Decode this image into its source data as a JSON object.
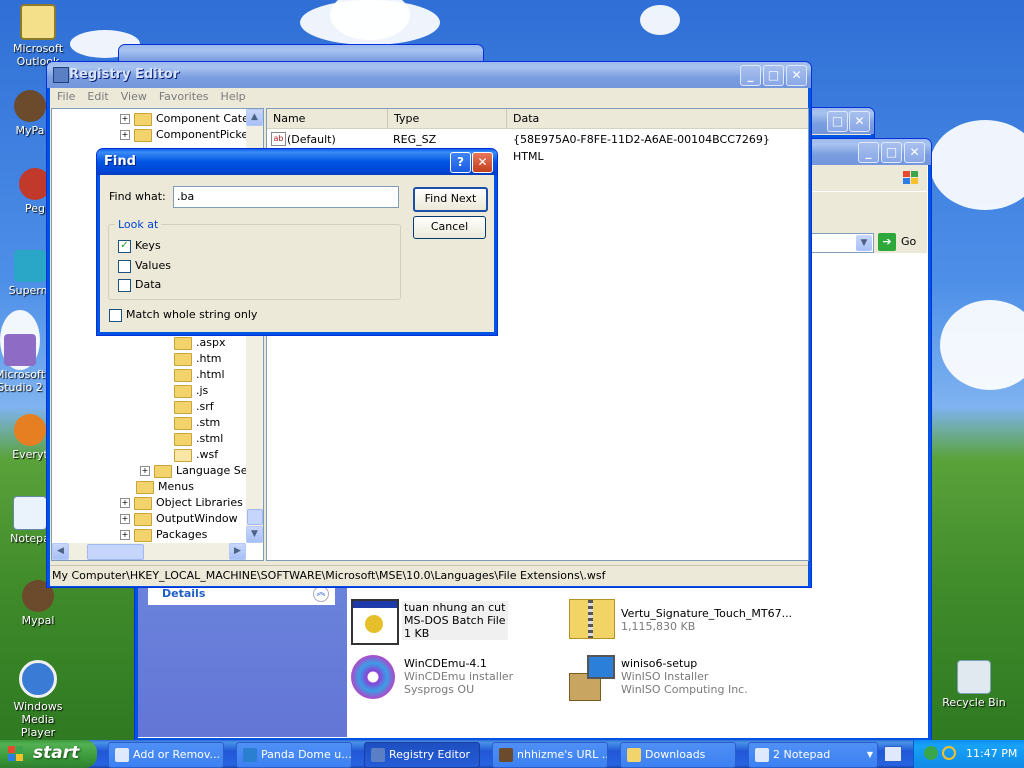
{
  "desktop": {
    "icons": [
      {
        "label": "Microsoft Outlook",
        "icon": "outlook-icon"
      },
      {
        "label": "MyPa",
        "icon": "mypa-icon"
      },
      {
        "label": "Peg",
        "icon": "peg-icon"
      },
      {
        "label": "Superm",
        "icon": "superm-icon"
      },
      {
        "label": "Microsoft Studio 2",
        "icon": "studio-icon"
      },
      {
        "label": "Everyt",
        "icon": "everything-icon"
      },
      {
        "label": "Notepa",
        "icon": "notepad-icon"
      },
      {
        "label": "Mypal",
        "icon": "mypal-icon"
      },
      {
        "label": "Windows Media Player",
        "icon": "media-player-icon"
      },
      {
        "label": "Recycle Bin",
        "icon": "recycle-bin-icon"
      }
    ]
  },
  "explorer": {
    "go_label": "Go",
    "details_label": "Details",
    "files": [
      {
        "name": "tuan nhung an cut",
        "line2": "MS-DOS Batch File",
        "line3": "1 KB",
        "icon": "batch-file-icon"
      },
      {
        "name": "Vertu_Signature_Touch_MT67...",
        "line2": "1,115,830 KB",
        "line3": "",
        "icon": "zip-folder-icon"
      },
      {
        "name": "WinCDEmu-4.1",
        "line2": "WinCDEmu installer",
        "line3": "Sysprogs OU",
        "icon": "disc-icon"
      },
      {
        "name": "winiso6-setup",
        "line2": "WinISO Installer",
        "line3": "WinISO Computing Inc.",
        "icon": "installer-icon"
      }
    ]
  },
  "regedit": {
    "title": "Registry Editor",
    "menu": [
      "File",
      "Edit",
      "View",
      "Favorites",
      "Help"
    ],
    "tree": [
      {
        "label": "Component Categ",
        "expander": "+"
      },
      {
        "label": "ComponentPickerF",
        "expander": "+"
      },
      {
        "label": ".aspx",
        "expander": ""
      },
      {
        "label": ".htm",
        "expander": ""
      },
      {
        "label": ".html",
        "expander": ""
      },
      {
        "label": ".js",
        "expander": ""
      },
      {
        "label": ".srf",
        "expander": ""
      },
      {
        "label": ".stm",
        "expander": ""
      },
      {
        "label": ".stml",
        "expander": ""
      },
      {
        "label": ".wsf",
        "expander": ""
      },
      {
        "label": "Language Serv",
        "expander": "+"
      },
      {
        "label": "Menus",
        "expander": ""
      },
      {
        "label": "Object Libraries",
        "expander": "+"
      },
      {
        "label": "OutputWindow",
        "expander": "+"
      },
      {
        "label": "Packages",
        "expander": "+"
      }
    ],
    "columns": [
      "Name",
      "Type",
      "Data"
    ],
    "values": [
      {
        "name": "(Default)",
        "type": "REG_SZ",
        "data": "{58E975A0-F8FE-11D2-A6AE-00104BCC7269}"
      },
      {
        "name": "",
        "type": "",
        "data": "HTML"
      }
    ],
    "status": "My Computer\\HKEY_LOCAL_MACHINE\\SOFTWARE\\Microsoft\\MSE\\10.0\\Languages\\File Extensions\\.wsf"
  },
  "find": {
    "title": "Find",
    "find_what_label": "Find what:",
    "find_what_value": ".ba",
    "find_next": "Find Next",
    "cancel": "Cancel",
    "look_at": "Look at",
    "keys": "Keys",
    "values": "Values",
    "data": "Data",
    "match_whole": "Match whole string only",
    "keys_checked": true,
    "values_checked": false,
    "data_checked": false,
    "match_whole_checked": false
  },
  "taskbar": {
    "start": "start",
    "tasks": [
      {
        "label": "Add or Remov...",
        "active": false
      },
      {
        "label": "Panda Dome u...",
        "active": false
      },
      {
        "label": "Registry Editor",
        "active": true
      },
      {
        "label": "nhhizme's URL ...",
        "active": false
      },
      {
        "label": "Downloads",
        "active": false
      },
      {
        "label": "2 Notepad",
        "active": false
      }
    ],
    "clock": "11:47 PM"
  },
  "colors": {
    "xp_blue": "#0054e3",
    "start_green": "#389438",
    "folder_yellow": "#f3d36b"
  }
}
